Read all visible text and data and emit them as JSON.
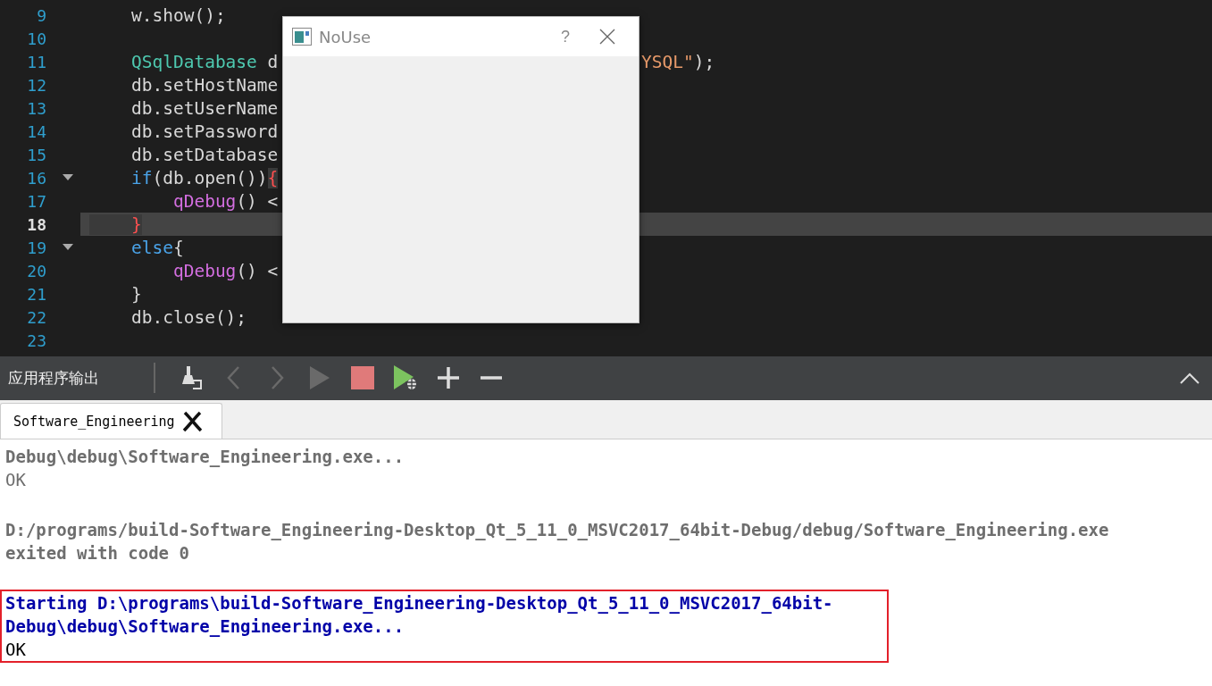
{
  "editor": {
    "lines": [
      {
        "number": "9",
        "current": false,
        "foldable": false,
        "segments": [
          {
            "text": "    w.show();",
            "kind": "plain"
          }
        ]
      },
      {
        "number": "10",
        "current": false,
        "foldable": false
      },
      {
        "number": "11",
        "current": false,
        "foldable": false,
        "segments": [
          {
            "text": "    QSqlDatabase",
            "kind": "type"
          },
          {
            "text": " d",
            "kind": "plain"
          }
        ],
        "after": [
          {
            "text": "YSQL\"",
            "kind": "string"
          },
          {
            "text": ");",
            "kind": "plain"
          }
        ]
      },
      {
        "number": "12",
        "current": false,
        "foldable": false,
        "segments": [
          {
            "text": "    db.setHostName",
            "kind": "plain"
          }
        ]
      },
      {
        "number": "13",
        "current": false,
        "foldable": false,
        "segments": [
          {
            "text": "    db.setUserName",
            "kind": "plain"
          }
        ]
      },
      {
        "number": "14",
        "current": false,
        "foldable": false,
        "segments": [
          {
            "text": "    db.setPassword",
            "kind": "plain"
          }
        ]
      },
      {
        "number": "15",
        "current": false,
        "foldable": false,
        "segments": [
          {
            "text": "    db.setDatabase",
            "kind": "plain"
          }
        ]
      },
      {
        "number": "16",
        "current": false,
        "foldable": true,
        "segments": [
          {
            "text": "    if",
            "kind": "keyword"
          },
          {
            "text": "(db.open())",
            "kind": "plain"
          },
          {
            "text": "{",
            "kind": "brace"
          }
        ]
      },
      {
        "number": "17",
        "current": false,
        "foldable": false,
        "segments": [
          {
            "text": "        qDebug",
            "kind": "func"
          },
          {
            "text": "() <",
            "kind": "plain"
          }
        ]
      },
      {
        "number": "18",
        "current": true,
        "foldable": false,
        "segments": [
          {
            "text": "    }",
            "kind": "brace"
          }
        ]
      },
      {
        "number": "19",
        "current": false,
        "foldable": true,
        "segments": [
          {
            "text": "    else",
            "kind": "keyword"
          },
          {
            "text": "{",
            "kind": "plain"
          }
        ]
      },
      {
        "number": "20",
        "current": false,
        "foldable": false,
        "segments": [
          {
            "text": "        qDebug",
            "kind": "func"
          },
          {
            "text": "() <",
            "kind": "plain"
          }
        ]
      },
      {
        "number": "21",
        "current": false,
        "foldable": false,
        "segments": [
          {
            "text": "    }",
            "kind": "plain"
          }
        ]
      },
      {
        "number": "22",
        "current": false,
        "foldable": false,
        "segments": [
          {
            "text": "    db.close();",
            "kind": "plain"
          }
        ]
      },
      {
        "number": "23",
        "current": false,
        "foldable": false
      }
    ]
  },
  "dialog": {
    "title": "NoUse",
    "help": "?"
  },
  "output_pane": {
    "title": "应用程序输出",
    "tools": [
      {
        "kind": "clear",
        "disabled": false
      },
      {
        "kind": "prev",
        "disabled": true
      },
      {
        "kind": "next",
        "disabled": true
      },
      {
        "kind": "run",
        "disabled": true
      },
      {
        "kind": "stop",
        "disabled": false
      },
      {
        "kind": "debug",
        "disabled": false
      },
      {
        "kind": "zoom_in",
        "disabled": false
      },
      {
        "kind": "zoom_out",
        "disabled": false
      }
    ],
    "tabs": [
      {
        "label": "Software_Engineering",
        "selected": true
      }
    ],
    "blocks": [
      {
        "current": false,
        "lines": [
          {
            "text": "Debug\\debug\\Software_Engineering.exe...",
            "kind": "status"
          },
          {
            "text": "OK",
            "kind": "program"
          }
        ]
      },
      {
        "current": false,
        "lines": [
          {
            "text": "D:/programs/build-Software_Engineering-Desktop_Qt_5_11_0_MSVC2017_64bit-Debug/debug/Software_Engineering.exe",
            "kind": "status"
          },
          {
            "text": "exited with code 0",
            "kind": "status"
          }
        ]
      },
      {
        "current": true,
        "lines": [
          {
            "text": "Starting D:\\programs\\build-Software_Engineering-Desktop_Qt_5_11_0_MSVC2017_64bit-",
            "kind": "status"
          },
          {
            "text": "Debug\\debug\\Software_Engineering.exe...",
            "kind": "status"
          },
          {
            "text": "OK",
            "kind": "program"
          }
        ]
      }
    ]
  }
}
